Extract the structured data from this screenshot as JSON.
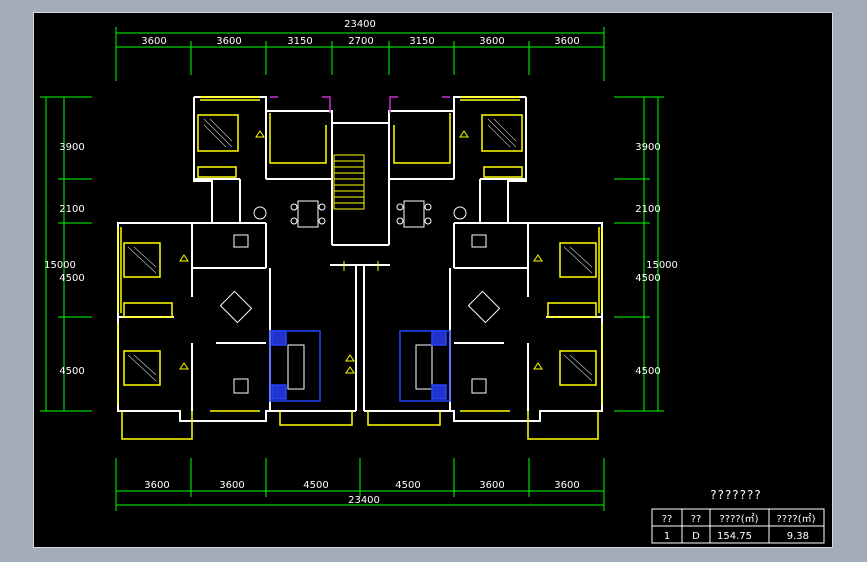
{
  "colors": {
    "background": "#000000",
    "frame": "#c0c0c0",
    "wall": "#ffffff",
    "dimension": "#00ff00",
    "furniture": "#ffff00",
    "door": "#cc33cc",
    "fixture": "#0033ff",
    "text": "#ffffff"
  },
  "dimensions": {
    "top_total": "23400",
    "top_segments": [
      "3600",
      "3600",
      "3150",
      "2700",
      "3150",
      "3600",
      "3600"
    ],
    "bottom_total": "23400",
    "bottom_segments": [
      "3600",
      "3600",
      "4500",
      "4500",
      "3600",
      "3600"
    ],
    "left_segments": [
      "3900",
      "2100",
      "4500",
      "4500"
    ],
    "left_total": "15000",
    "right_segments": [
      "3900",
      "2100",
      "4500",
      "4500"
    ],
    "right_total": "15000"
  },
  "title_block": {
    "title": "???????",
    "headers": [
      "??",
      "??",
      "????(㎡)",
      "????(㎡)"
    ],
    "row": [
      "1",
      "D",
      "154.75",
      "9.38"
    ]
  }
}
